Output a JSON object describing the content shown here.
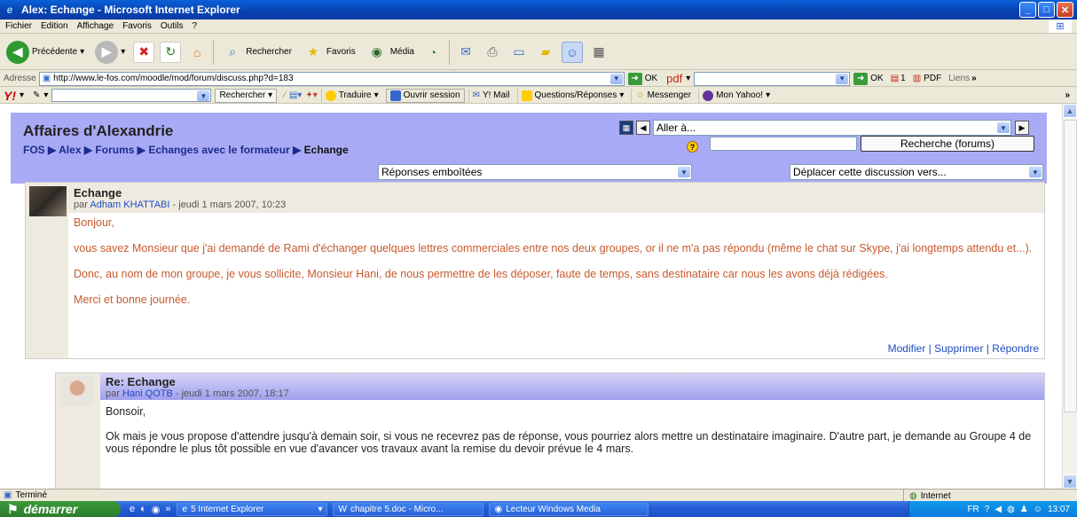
{
  "window": {
    "title": "Alex: Echange - Microsoft Internet Explorer"
  },
  "menu": [
    "Fichier",
    "Edition",
    "Affichage",
    "Favoris",
    "Outils",
    "?"
  ],
  "toolbar": {
    "back": "Précédente",
    "search": "Rechercher",
    "favorites": "Favoris",
    "media": "Média"
  },
  "address": {
    "label": "Adresse",
    "url": "http://www.le-fos.com/moodle/mod/forum/discuss.php?d=183",
    "go": "OK",
    "pdf": "pdf",
    "go2": "OK",
    "badge": "1",
    "pdf2": "PDF",
    "links": "Liens"
  },
  "yahoo": {
    "search": "Rechercher",
    "translate": "Traduire",
    "session": "Ouvrir session",
    "mail": "Y! Mail",
    "qa": "Questions/Réponses",
    "messenger": "Messenger",
    "myyahoo": "Mon Yahoo!"
  },
  "moodle": {
    "site_name": "Affaires d'Alexandrie",
    "breadcrumb": [
      "FOS",
      "Alex",
      "Forums",
      "Echanges avec le formateur",
      "Echange"
    ],
    "jump_to": "Aller à...",
    "search_button": "Recherche (forums)",
    "display_mode": "Réponses emboîtées",
    "move_discussion": "Déplacer cette discussion vers..."
  },
  "posts": [
    {
      "subject": "Echange",
      "by_prefix": "par",
      "author": "Adham KHATTABI",
      "date": "- jeudi 1 mars 2007, 10:23",
      "paragraphs": [
        "Bonjour,",
        "vous savez Monsieur que j'ai demandé de Rami d'échanger quelques lettres commerciales entre nos deux groupes, or il ne m'a pas répondu (même le chat sur Skype, j'ai longtemps attendu et...).",
        "Donc, au nom de mon groupe, je vous sollicite, Monsieur Hani, de nous permettre de les déposer, faute de temps, sans destinataire car nous les avons déjà rédigées.",
        "Merci et bonne journée."
      ],
      "commands": [
        "Modifier",
        "Supprimer",
        "Répondre"
      ]
    },
    {
      "subject": "Re: Echange",
      "by_prefix": "par",
      "author": "Hani QOTB",
      "date": "- jeudi 1 mars 2007, 18:17",
      "paragraphs": [
        "Bonsoir,",
        "Ok mais je vous propose d'attendre jusqu'à demain soir, si vous ne recevrez pas de réponse, vous pourriez alors mettre un destinataire imaginaire. D'autre part, je demande au Groupe 4 de vous répondre le plus tôt possible en vue d'avancer vos travaux avant la remise du devoir prévue le 4 mars."
      ]
    }
  ],
  "status": {
    "text": "Terminé",
    "zone": "Internet"
  },
  "taskbar": {
    "start": "démarrer",
    "tasks": [
      "5 Internet Explorer",
      "chapitre 5.doc - Micro...",
      "Lecteur Windows Media"
    ],
    "lang": "FR",
    "time": "13:07"
  }
}
